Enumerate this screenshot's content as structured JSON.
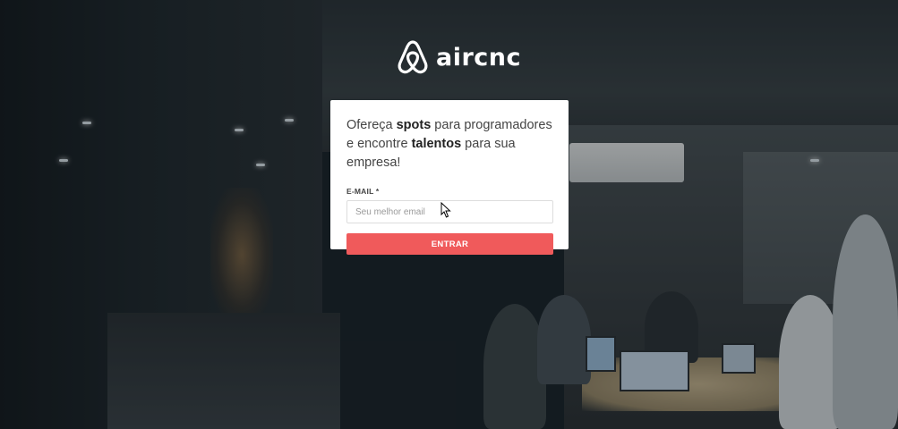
{
  "brand": {
    "name": "aircnc",
    "logo_icon": "airbnb-belo-icon"
  },
  "card": {
    "headline": {
      "part1": "Ofereça ",
      "bold1": "spots",
      "part2": " para programadores e encontre ",
      "bold2": "talentos",
      "part3": " para sua empresa!"
    },
    "email_label": "E-MAIL *",
    "email_placeholder": "Seu melhor email",
    "email_value": "",
    "submit_label": "ENTRAR"
  },
  "colors": {
    "accent": "#f05a5b",
    "card_bg": "#ffffff",
    "logo": "#ffffff"
  },
  "background": {
    "description_icon": "office-photo-background"
  }
}
